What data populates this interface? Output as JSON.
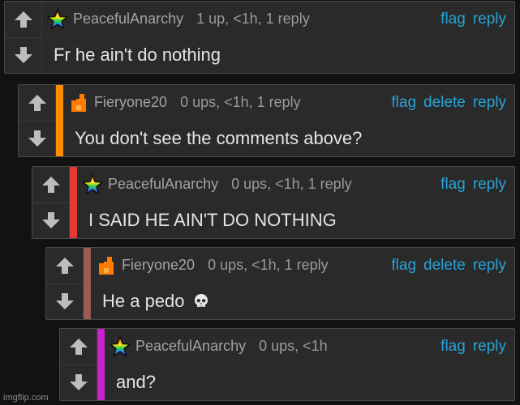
{
  "colors": {
    "background": "#121212",
    "card": "#2a2a2a",
    "link": "#28a3d6",
    "accent_level_2": "#ff8c00",
    "accent_level_3": "#e53935",
    "accent_level_4": "#9b5a52",
    "accent_level_5": "#cc22cc"
  },
  "icons": {
    "upvote": "arrow-up-icon",
    "downvote": "arrow-down-icon",
    "avatar_star": "rainbow-star-icon",
    "avatar_flame": "pixel-flame-icon",
    "skull": "skull-emoji"
  },
  "comments": [
    {
      "username": "PeacefulAnarchy",
      "stats": "1 up, <1h, 1 reply",
      "actions": [
        "flag",
        "reply"
      ],
      "body": "Fr he ain't do nothing"
    },
    {
      "username": "Fieryone20",
      "stats": "0 ups, <1h, 1 reply",
      "actions": [
        "flag",
        "delete",
        "reply"
      ],
      "body": "You don't see the comments above?"
    },
    {
      "username": "PeacefulAnarchy",
      "stats": "0 ups, <1h, 1 reply",
      "actions": [
        "flag",
        "reply"
      ],
      "body": "I SAID HE AIN'T DO NOTHING"
    },
    {
      "username": "Fieryone20",
      "stats": "0 ups, <1h, 1 reply",
      "actions": [
        "flag",
        "delete",
        "reply"
      ],
      "body": "He a pedo"
    },
    {
      "username": "PeacefulAnarchy",
      "stats": "0 ups, <1h",
      "actions": [
        "flag",
        "reply"
      ],
      "body": "and?"
    }
  ],
  "watermark": "imgflip.com"
}
